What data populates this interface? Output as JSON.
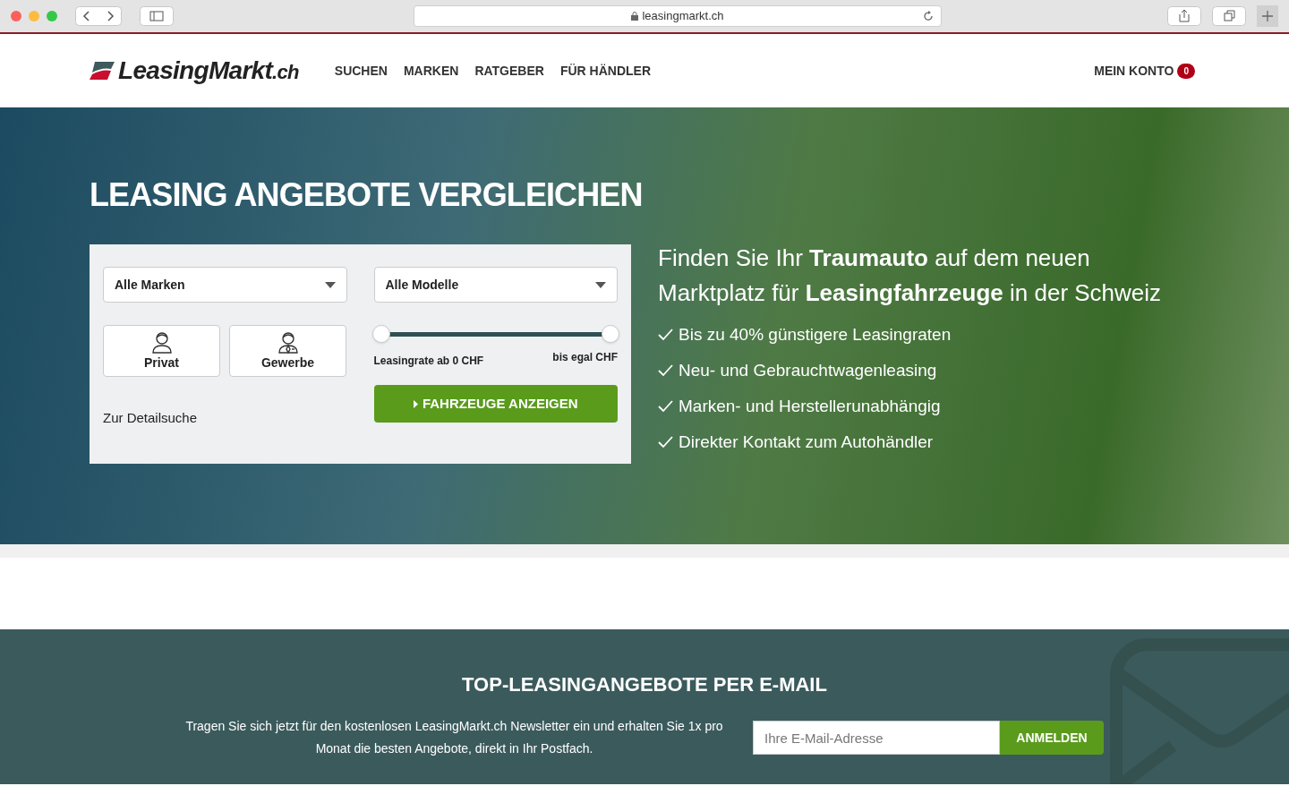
{
  "browser": {
    "url": "leasingmarkt.ch"
  },
  "header": {
    "logo": {
      "brand": "LeasingMarkt",
      "suffix": ".ch"
    },
    "nav": [
      {
        "label": "SUCHEN"
      },
      {
        "label": "MARKEN"
      },
      {
        "label": "RATGEBER"
      },
      {
        "label": "FÜR HÄNDLER"
      }
    ],
    "account": {
      "label": "MEIN KONTO",
      "badge": "0"
    }
  },
  "hero": {
    "title": "LEASING ANGEBOTE VERGLEICHEN",
    "search": {
      "brand_select": "Alle Marken",
      "model_select": "Alle Modelle",
      "customer_types": [
        {
          "kind": "private",
          "label": "Privat"
        },
        {
          "kind": "business",
          "label": "Gewerbe"
        }
      ],
      "rate_slider": {
        "thumbs": [
          {
            "level": 0
          },
          {
            "level": 1
          }
        ],
        "min_label": "Leasingrate ab 0 CHF",
        "max_label": "bis egal CHF"
      },
      "detail_link": "Zur Detailsuche",
      "submit": "FAHRZEUGE ANZEIGEN"
    },
    "headline": "Finden Sie Ihr **Traumauto** auf dem neuen Marktplatz für **Leasingfahrzeuge** in der Schweiz",
    "benefits": [
      "Bis zu 40% günstigere Leasingraten",
      "Neu- und Gebrauchtwagenleasing",
      "Marken- und Herstellerunabhängig",
      "Direkter Kontakt zum Autohändler"
    ]
  },
  "newsletter": {
    "title": "TOP-LEASINGANGEBOTE PER E-MAIL",
    "text": "Tragen Sie sich jetzt für den kostenlosen LeasingMarkt.ch Newsletter ein und erhalten Sie 1x pro Monat die besten Angebote, direkt in Ihr Postfach.",
    "placeholder": "Ihre E-Mail-Adresse",
    "button": "ANMELDEN"
  }
}
